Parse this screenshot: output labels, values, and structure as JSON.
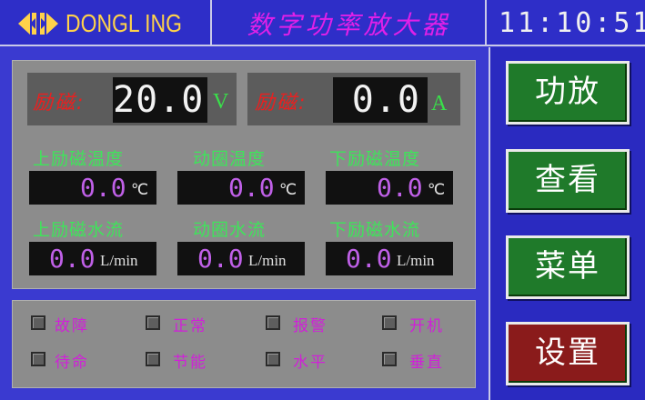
{
  "header": {
    "brand": "DONGL ING",
    "title": "数字功率放大器",
    "time": "11:10:51"
  },
  "readouts": [
    {
      "label": "励磁:",
      "value": "20.0",
      "unit": "V"
    },
    {
      "label": "励磁:",
      "value": "0.0",
      "unit": "A"
    }
  ],
  "temperatures": [
    {
      "label": "上励磁温度",
      "value": "0.0",
      "unit": "℃"
    },
    {
      "label": "动圈温度",
      "value": "0.0",
      "unit": "℃"
    },
    {
      "label": "下励磁温度",
      "value": "0.0",
      "unit": "℃"
    }
  ],
  "flows": [
    {
      "label": "上励磁水流",
      "value": "0.0",
      "unit": "L/min"
    },
    {
      "label": "动圈水流",
      "value": "0.0",
      "unit": "L/min"
    },
    {
      "label": "下励磁水流",
      "value": "0.0",
      "unit": "L/min"
    }
  ],
  "status": [
    {
      "label": "故障"
    },
    {
      "label": "正常"
    },
    {
      "label": "报警"
    },
    {
      "label": "开机"
    },
    {
      "label": "待命"
    },
    {
      "label": "节能"
    },
    {
      "label": "水平"
    },
    {
      "label": "垂直"
    }
  ],
  "buttons": {
    "amp": "功放",
    "view": "查看",
    "menu": "菜单",
    "settings": "设置"
  },
  "colors": {
    "background": "#3a3ad0",
    "panel": "#8c8c8c",
    "label_green": "#3ee55a",
    "label_red": "#e82020",
    "status_magenta": "#d020d8",
    "button_green": "#1f7a2a",
    "button_red": "#8a1b1b"
  }
}
